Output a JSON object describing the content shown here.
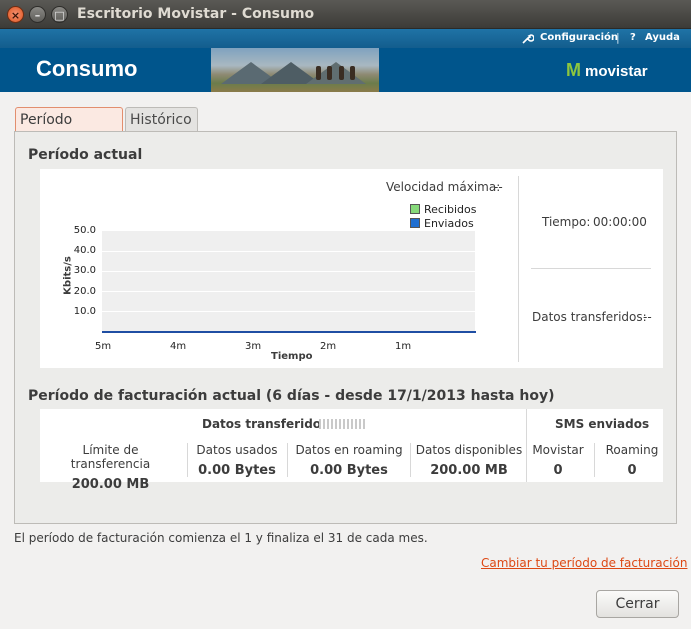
{
  "window": {
    "title": "Escritorio Movistar - Consumo"
  },
  "topbar": {
    "config_label": "Configuración",
    "help_label": "Ayuda"
  },
  "header": {
    "title": "Consumo",
    "brand": "movistar"
  },
  "tabs": [
    {
      "label": "Período actual",
      "active": true
    },
    {
      "label": "Histórico",
      "active": false
    }
  ],
  "current": {
    "heading": "Período actual",
    "max_speed_label": "Velocidad máxima:",
    "max_speed_value": "--",
    "legend": [
      {
        "label": "Recibidos",
        "color": "#86d97a"
      },
      {
        "label": "Enviados",
        "color": "#1f6fd1"
      }
    ],
    "time_label": "Tiempo:",
    "time_value": "00:00:00",
    "transferred_label": "Datos transferidos:",
    "transferred_value": "--"
  },
  "chart_data": {
    "type": "line",
    "ylabel": "Kbits/s",
    "xlabel": "Tiempo",
    "yticks": [
      "10.0",
      "20.0",
      "30.0",
      "40.0",
      "50.0"
    ],
    "xticks": [
      "5m",
      "4m",
      "3m",
      "2m",
      "1m"
    ],
    "ylim": [
      0,
      50
    ],
    "series": [
      {
        "name": "Recibidos",
        "values": []
      },
      {
        "name": "Enviados",
        "values": []
      }
    ]
  },
  "billing": {
    "heading": "Período de facturación actual (6 días - desde 17/1/2013 hasta hoy)",
    "data_header": "Datos transferidos",
    "sms_header": "SMS enviados",
    "columns": [
      {
        "label": "Límite de transferencia",
        "value": "200.00 MB"
      },
      {
        "label": "Datos usados",
        "value": "0.00 Bytes"
      },
      {
        "label": "Datos en roaming",
        "value": "0.00 Bytes"
      },
      {
        "label": "Datos disponibles",
        "value": "200.00 MB"
      }
    ],
    "sms_columns": [
      {
        "label": "Movistar",
        "value": "0"
      },
      {
        "label": "Roaming",
        "value": "0"
      }
    ]
  },
  "footer": {
    "note": "El período de facturación comienza el 1 y finaliza el 31 de cada mes.",
    "change_link": "Cambiar tu período de facturación",
    "close_button": "Cerrar"
  }
}
